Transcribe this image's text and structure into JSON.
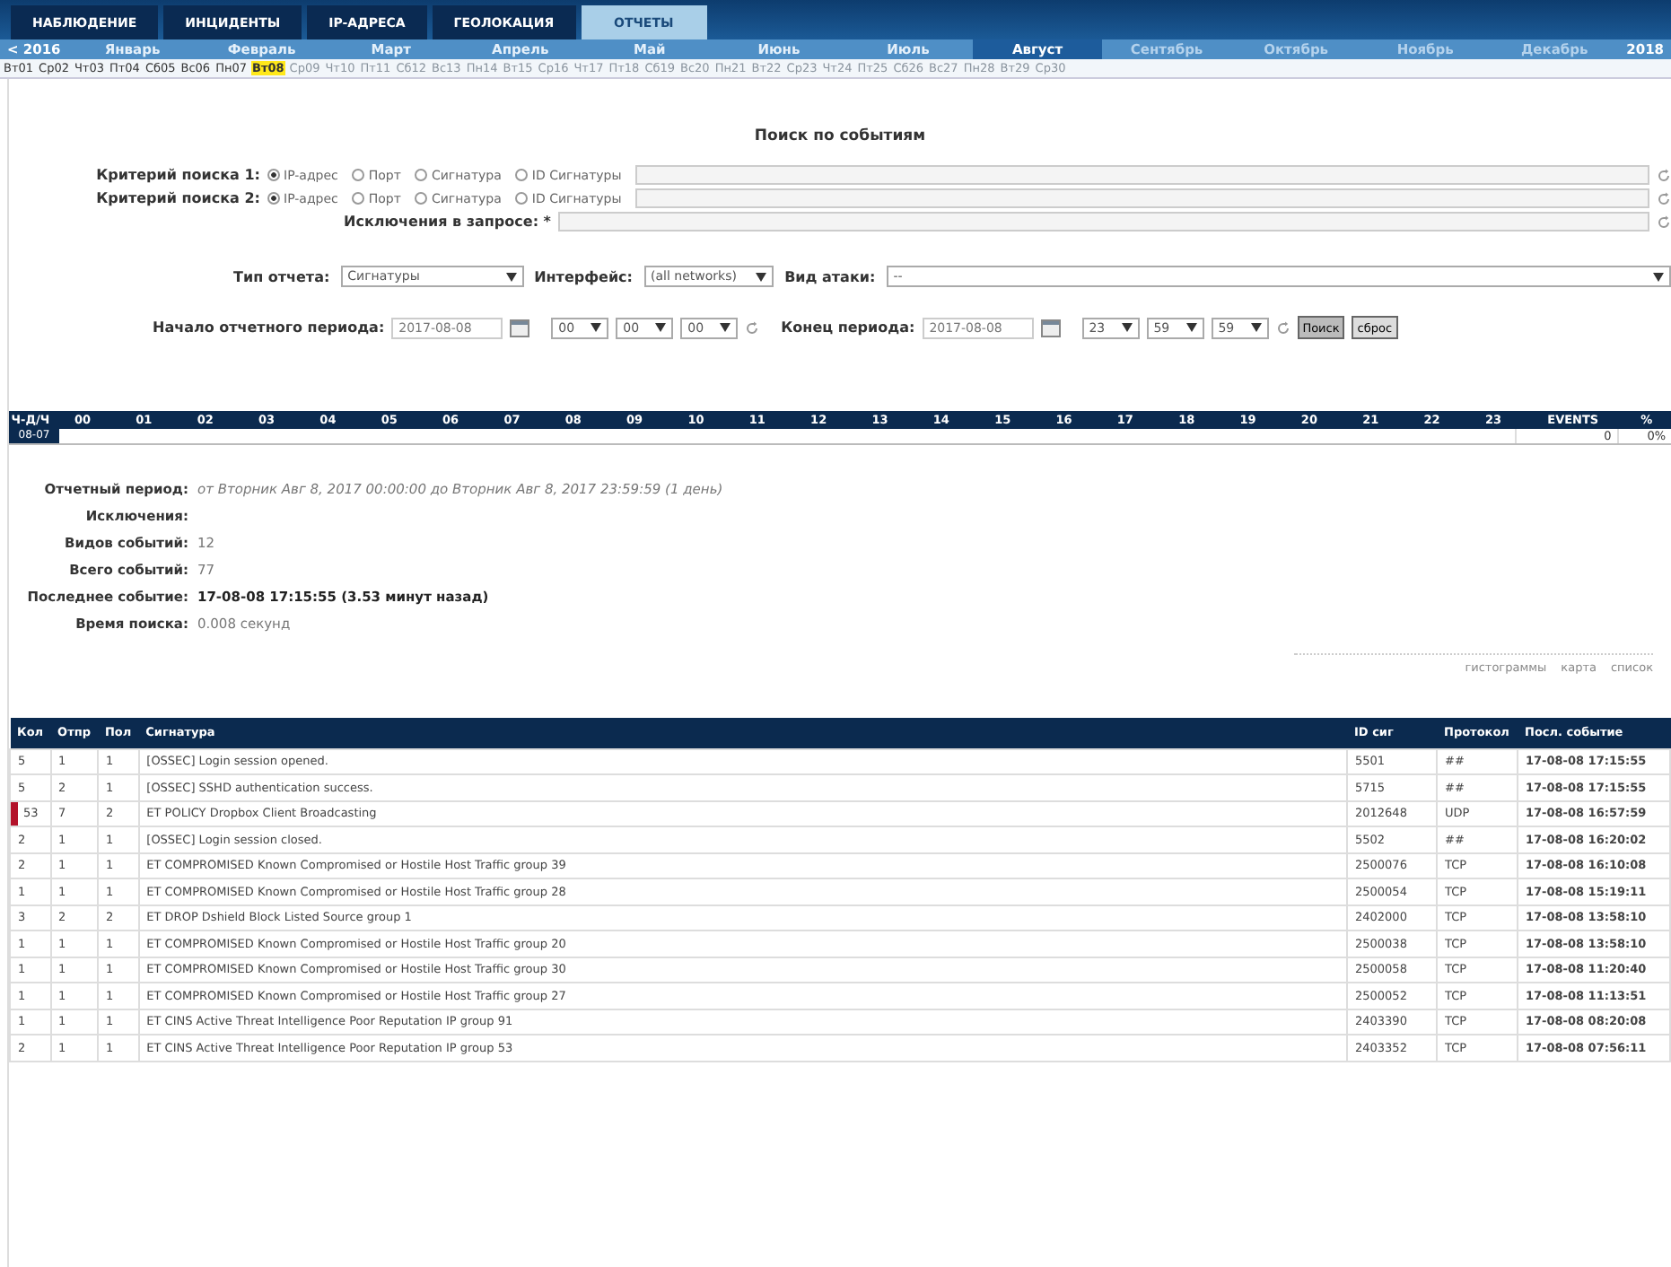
{
  "nav_tabs": [
    {
      "label": "НАБЛЮДЕНИЕ",
      "selected": false
    },
    {
      "label": "ИНЦИДЕНТЫ",
      "selected": false
    },
    {
      "label": "IP-АДРЕСА",
      "selected": false
    },
    {
      "label": "ГЕОЛОКАЦИЯ",
      "selected": false
    },
    {
      "label": "ОТЧЕТЫ",
      "selected": true
    }
  ],
  "months": {
    "prev_year": "< 2016",
    "next_year": "2018",
    "items": [
      {
        "label": "Январь",
        "selected": false,
        "disabled": false
      },
      {
        "label": "Февраль",
        "selected": false,
        "disabled": false
      },
      {
        "label": "Март",
        "selected": false,
        "disabled": false
      },
      {
        "label": "Апрель",
        "selected": false,
        "disabled": false
      },
      {
        "label": "Май",
        "selected": false,
        "disabled": false
      },
      {
        "label": "Июнь",
        "selected": false,
        "disabled": false
      },
      {
        "label": "Июль",
        "selected": false,
        "disabled": false
      },
      {
        "label": "Август",
        "selected": true,
        "disabled": false
      },
      {
        "label": "Сентябрь",
        "selected": false,
        "disabled": true
      },
      {
        "label": "Октябрь",
        "selected": false,
        "disabled": true
      },
      {
        "label": "Ноябрь",
        "selected": false,
        "disabled": true
      },
      {
        "label": "Декабрь",
        "selected": false,
        "disabled": true
      }
    ]
  },
  "days": [
    {
      "label": "Вт01",
      "selected": false,
      "disabled": false
    },
    {
      "label": "Ср02",
      "selected": false,
      "disabled": false
    },
    {
      "label": "Чт03",
      "selected": false,
      "disabled": false
    },
    {
      "label": "Пт04",
      "selected": false,
      "disabled": false
    },
    {
      "label": "Сб05",
      "selected": false,
      "disabled": false
    },
    {
      "label": "Вс06",
      "selected": false,
      "disabled": false
    },
    {
      "label": "Пн07",
      "selected": false,
      "disabled": false
    },
    {
      "label": "Вт08",
      "selected": true,
      "disabled": false
    },
    {
      "label": "Ср09",
      "selected": false,
      "disabled": true
    },
    {
      "label": "Чт10",
      "selected": false,
      "disabled": true
    },
    {
      "label": "Пт11",
      "selected": false,
      "disabled": true
    },
    {
      "label": "Сб12",
      "selected": false,
      "disabled": true
    },
    {
      "label": "Вс13",
      "selected": false,
      "disabled": true
    },
    {
      "label": "Пн14",
      "selected": false,
      "disabled": true
    },
    {
      "label": "Вт15",
      "selected": false,
      "disabled": true
    },
    {
      "label": "Ср16",
      "selected": false,
      "disabled": true
    },
    {
      "label": "Чт17",
      "selected": false,
      "disabled": true
    },
    {
      "label": "Пт18",
      "selected": false,
      "disabled": true
    },
    {
      "label": "Сб19",
      "selected": false,
      "disabled": true
    },
    {
      "label": "Вс20",
      "selected": false,
      "disabled": true
    },
    {
      "label": "Пн21",
      "selected": false,
      "disabled": true
    },
    {
      "label": "Вт22",
      "selected": false,
      "disabled": true
    },
    {
      "label": "Ср23",
      "selected": false,
      "disabled": true
    },
    {
      "label": "Чт24",
      "selected": false,
      "disabled": true
    },
    {
      "label": "Пт25",
      "selected": false,
      "disabled": true
    },
    {
      "label": "Сб26",
      "selected": false,
      "disabled": true
    },
    {
      "label": "Вс27",
      "selected": false,
      "disabled": true
    },
    {
      "label": "Пн28",
      "selected": false,
      "disabled": true
    },
    {
      "label": "Вт29",
      "selected": false,
      "disabled": true
    },
    {
      "label": "Ср30",
      "selected": false,
      "disabled": true
    }
  ],
  "search": {
    "title": "Поиск по событиям",
    "criteria": [
      {
        "label": "Критерий поиска 1:",
        "options": [
          {
            "label": "IP-адрес",
            "selected": true
          },
          {
            "label": "Порт",
            "selected": false
          },
          {
            "label": "Сигнатура",
            "selected": false
          },
          {
            "label": "ID Сигнатуры",
            "selected": false
          }
        ]
      },
      {
        "label": "Критерий поиска 2:",
        "options": [
          {
            "label": "IP-адрес",
            "selected": true
          },
          {
            "label": "Порт",
            "selected": false
          },
          {
            "label": "Сигнатура",
            "selected": false
          },
          {
            "label": "ID Сигнатуры",
            "selected": false
          }
        ]
      }
    ],
    "exclusions_label": "Исключения в запросе: *",
    "filters": [
      {
        "label": "Тип отчета:",
        "value": "Сигнатуры"
      },
      {
        "label": "Интерфейс:",
        "value": "(all networks)"
      },
      {
        "label": "Вид атаки:",
        "value": "--"
      }
    ],
    "period": [
      {
        "label": "Начало отчетного периода:",
        "date": "2017-08-08",
        "times": [
          "00",
          "00",
          "00"
        ]
      },
      {
        "label": "Конец периода:",
        "date": "2017-08-08",
        "times": [
          "23",
          "59",
          "59"
        ]
      }
    ],
    "buttons": [
      "Поиск",
      "сброс"
    ]
  },
  "timeline": {
    "corner": "Ч-Д/Ч",
    "hours": [
      "00",
      "01",
      "02",
      "03",
      "04",
      "05",
      "06",
      "07",
      "08",
      "09",
      "10",
      "11",
      "12",
      "13",
      "14",
      "15",
      "16",
      "17",
      "18",
      "19",
      "20",
      "21",
      "22",
      "23"
    ],
    "events_header": "EVENTS",
    "percent_header": "%",
    "row_label": "08-07",
    "events": "0",
    "percent": "0%"
  },
  "summary": [
    {
      "label": "Отчетный период:",
      "value": "от Вторник Авг 8, 2017 00:00:00 до Вторник Авг 8, 2017 23:59:59 *(1 день)*",
      "kind": "italic"
    },
    {
      "label": "Исключения:"
    },
    {
      "label": "Видов событий:",
      "value": "12",
      "kind": "plain"
    },
    {
      "label": "Всего событий:",
      "value": "77",
      "kind": "plain"
    },
    {
      "label": "Последнее событие:",
      "value": "17-08-08 17:15:55 (3.53 минут назад)",
      "kind": "bold"
    },
    {
      "label": "Время поиска:",
      "value": "0.008 секунд",
      "kind": "plain"
    }
  ],
  "views": [
    "гистограммы",
    "карта",
    "список"
  ],
  "table": {
    "columns": [
      "Кол",
      "Отпр",
      "Пол",
      "Сигнатура",
      "ID сиг",
      "Протокол",
      "Посл. событие"
    ],
    "rows": [
      {
        "highlighted": false,
        "cells": [
          "5",
          "1",
          "1",
          "[OSSEC] Login session opened.",
          "5501",
          "##",
          "17-08-08 17:15:55"
        ]
      },
      {
        "highlighted": false,
        "cells": [
          "5",
          "2",
          "1",
          "[OSSEC] SSHD authentication success.",
          "5715",
          "##",
          "17-08-08 17:15:55"
        ]
      },
      {
        "highlighted": true,
        "cells": [
          "53",
          "7",
          "2",
          "ET POLICY Dropbox Client Broadcasting",
          "2012648",
          "UDP",
          "17-08-08 16:57:59"
        ]
      },
      {
        "highlighted": false,
        "cells": [
          "2",
          "1",
          "1",
          "[OSSEC] Login session closed.",
          "5502",
          "##",
          "17-08-08 16:20:02"
        ]
      },
      {
        "highlighted": false,
        "cells": [
          "2",
          "1",
          "1",
          "ET COMPROMISED Known Compromised or Hostile Host Traffic group 39",
          "2500076",
          "TCP",
          "17-08-08 16:10:08"
        ]
      },
      {
        "highlighted": false,
        "cells": [
          "1",
          "1",
          "1",
          "ET COMPROMISED Known Compromised or Hostile Host Traffic group 28",
          "2500054",
          "TCP",
          "17-08-08 15:19:11"
        ]
      },
      {
        "highlighted": false,
        "cells": [
          "3",
          "2",
          "2",
          "ET DROP Dshield Block Listed Source group 1",
          "2402000",
          "TCP",
          "17-08-08 13:58:10"
        ]
      },
      {
        "highlighted": false,
        "cells": [
          "1",
          "1",
          "1",
          "ET COMPROMISED Known Compromised or Hostile Host Traffic group 20",
          "2500038",
          "TCP",
          "17-08-08 13:58:10"
        ]
      },
      {
        "highlighted": false,
        "cells": [
          "1",
          "1",
          "1",
          "ET COMPROMISED Known Compromised or Hostile Host Traffic group 30",
          "2500058",
          "TCP",
          "17-08-08 11:20:40"
        ]
      },
      {
        "highlighted": false,
        "cells": [
          "1",
          "1",
          "1",
          "ET COMPROMISED Known Compromised or Hostile Host Traffic group 27",
          "2500052",
          "TCP",
          "17-08-08 11:13:51"
        ]
      },
      {
        "highlighted": false,
        "cells": [
          "1",
          "1",
          "1",
          "ET CINS Active Threat Intelligence Poor Reputation IP group 91",
          "2403390",
          "TCP",
          "17-08-08 08:20:08"
        ]
      },
      {
        "highlighted": false,
        "cells": [
          "2",
          "1",
          "1",
          "ET CINS Active Threat Intelligence Poor Reputation IP group 53",
          "2403352",
          "TCP",
          "17-08-08 07:56:11"
        ]
      }
    ]
  }
}
